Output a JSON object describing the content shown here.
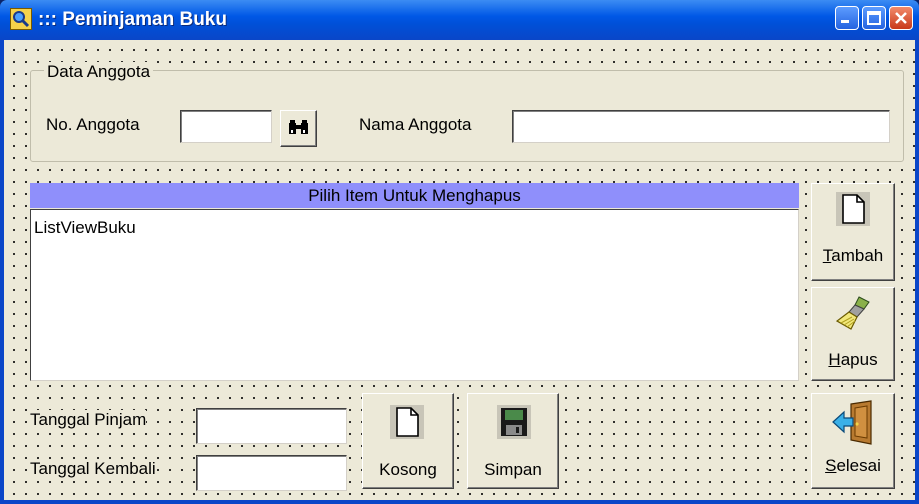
{
  "window": {
    "title": "::: Peminjaman Buku"
  },
  "group": {
    "legend": "Data Anggota",
    "no_anggota_label": "No. Anggota",
    "no_anggota_value": "",
    "nama_anggota_label": "Nama Anggota",
    "nama_anggota_value": ""
  },
  "list": {
    "header": "Pilih Item Untuk Menghapus",
    "name": "ListViewBuku"
  },
  "buttons": {
    "tambah_mnemonic": "T",
    "tambah_rest": "ambah",
    "hapus_mnemonic": "H",
    "hapus_rest": "apus",
    "selesai_mnemonic": "S",
    "selesai_rest": "elesai",
    "kosong": "Kosong",
    "simpan": "Simpan"
  },
  "dates": {
    "pinjam_label": "Tanggal Pinjam",
    "pinjam_value": "",
    "kembali_label": "Tanggal Kembali",
    "kembali_value": ""
  }
}
